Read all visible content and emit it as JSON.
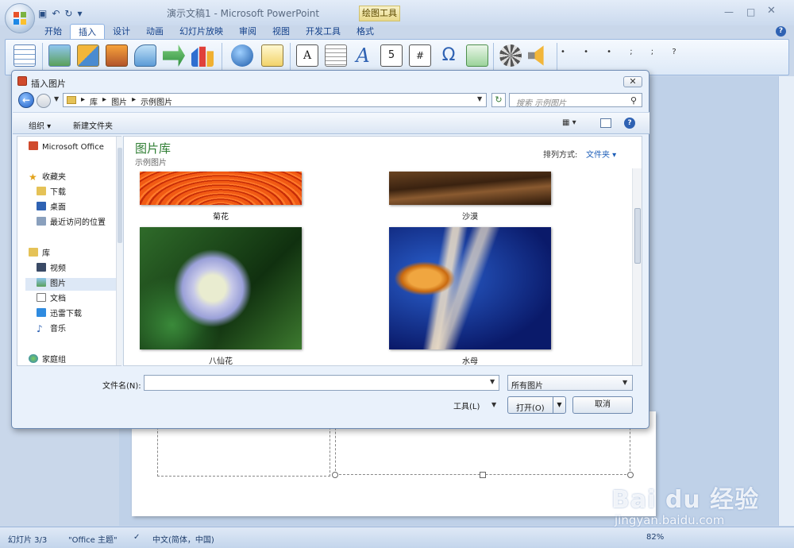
{
  "app": {
    "title": "演示文稿1 - Microsoft PowerPoint",
    "context_tab": "绘图工具",
    "tabs": [
      "开始",
      "插入",
      "设计",
      "动画",
      "幻灯片放映",
      "审阅",
      "视图",
      "开发工具",
      "格式"
    ],
    "active_tab": "插入"
  },
  "ribbon": {
    "icons": [
      "table-icon",
      "picture-icon",
      "clipart-icon",
      "photo-album-icon",
      "shapes-icon",
      "smartart-icon",
      "chart-icon",
      "hyperlink-icon",
      "action-icon",
      "textbox-icon",
      "header-footer-icon",
      "wordart-icon",
      "date-time-icon",
      "slide-number-icon",
      "symbol-icon",
      "object-icon",
      "movie-icon",
      "sound-icon"
    ],
    "dots": "• • • ; ; ?"
  },
  "dialog": {
    "title": "插入图片",
    "path": [
      "库",
      "图片",
      "示例图片"
    ],
    "search_placeholder": "搜索 示例图片",
    "toolbar": {
      "organize": "组织 ▾",
      "new_folder": "新建文件夹"
    },
    "nav": {
      "office": "Microsoft Office",
      "favorites": "收藏夹",
      "favorites_items": [
        "下载",
        "桌面",
        "最近访问的位置"
      ],
      "libraries": "库",
      "library_items": [
        "视频",
        "图片",
        "文档",
        "迅雷下载",
        "音乐"
      ],
      "homegroup": "家庭组"
    },
    "library": {
      "title": "图片库",
      "subtitle": "示例图片",
      "arrange_label": "排列方式:",
      "arrange_value": "文件夹 ▾"
    },
    "images": [
      "菊花",
      "沙漠",
      "八仙花",
      "水母"
    ],
    "filename_label": "文件名(N):",
    "filename_value": "",
    "filter": "所有图片",
    "tools": "工具(L)",
    "open": "打开(O)",
    "cancel": "取消"
  },
  "status": {
    "slide": "幻灯片 3/3",
    "theme": "\"Office 主题\"",
    "language": "中文(简体，中国)",
    "zoom": "82%"
  },
  "watermark": {
    "brand": "Bai du 经验",
    "url": "jingyan.baidu.com"
  },
  "colors": {
    "accent": "#15428b",
    "library_title": "#2e7d32",
    "ribbon_bg": "#dde9f7"
  }
}
